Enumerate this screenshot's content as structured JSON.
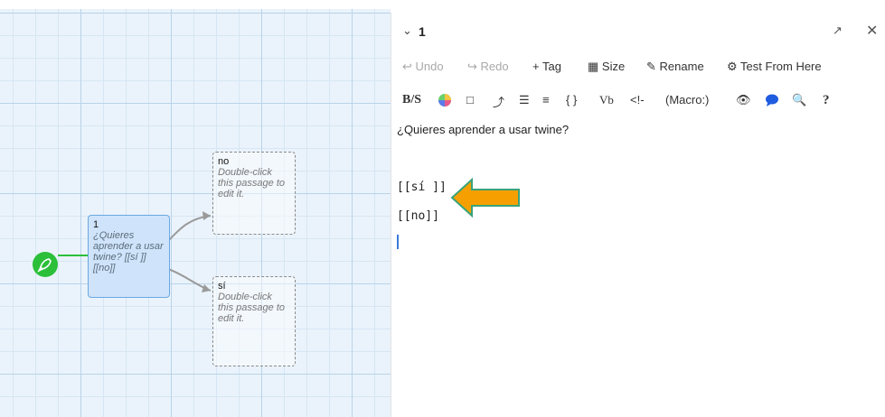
{
  "canvas": {
    "main_passage": {
      "title": "1",
      "excerpt": "¿Quieres aprender a usar twine? [[sí ]] [[no]]"
    },
    "passage_no": {
      "title": "no",
      "excerpt": "Double-click this passage to edit it."
    },
    "passage_si": {
      "title": "sí",
      "excerpt": "Double-click this passage to edit it."
    }
  },
  "dialog": {
    "title": "1",
    "toolbar": {
      "undo": "Undo",
      "redo": "Redo",
      "tag": "Tag",
      "size": "Size",
      "rename": "Rename",
      "test": "Test From Here"
    },
    "format_toolbar": {
      "bs": "B/S",
      "vb": "Vb",
      "comment": "<!-",
      "macro": "(Macro:)",
      "help": "?"
    },
    "editor": {
      "line1": "¿Quieres aprender a usar twine?",
      "line2": "[[sí ]]",
      "line3": "[[no]]"
    }
  },
  "colors": {
    "accent_green": "#2bbf3a",
    "arrow_orange": "#f5a000",
    "passage_blue": "#cfe4fb"
  }
}
